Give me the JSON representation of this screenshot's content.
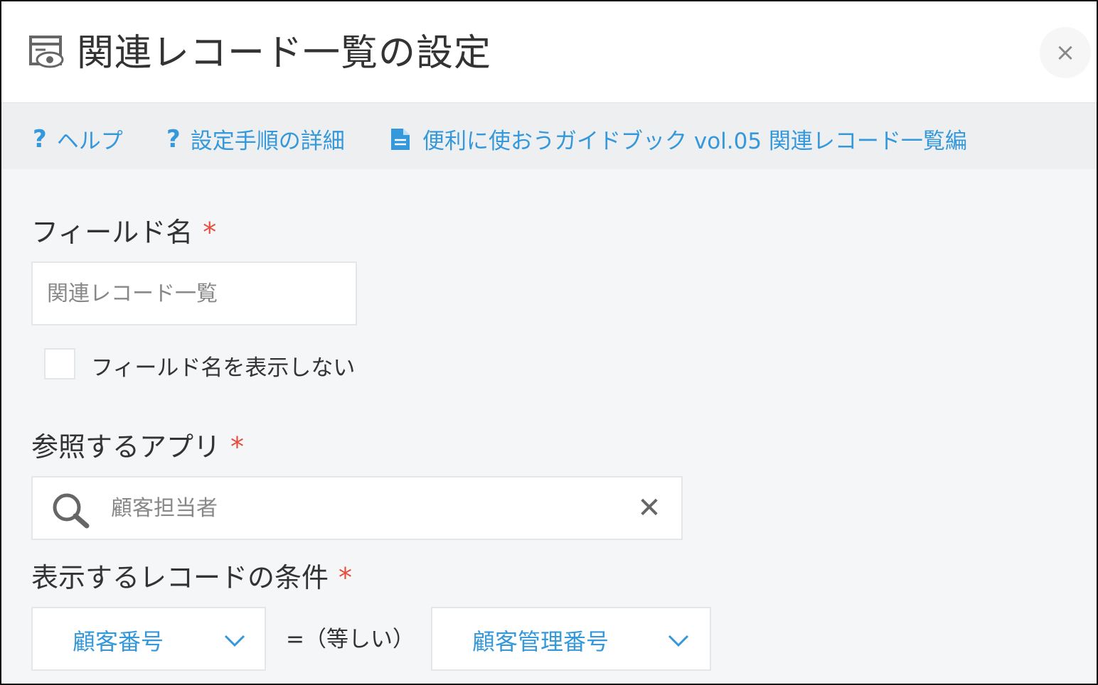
{
  "dialog": {
    "title": "関連レコード一覧の設定",
    "close_icon": "×"
  },
  "help_links": [
    {
      "icon": "?",
      "label": "ヘルプ"
    },
    {
      "icon": "?",
      "label": "設定手順の詳細"
    },
    {
      "icon": "document-icon",
      "label": "便利に使おうガイドブック vol.05 関連レコード一覧編"
    }
  ],
  "field_name": {
    "label": "フィールド名",
    "required_mark": "*",
    "placeholder": "関連レコード一覧",
    "value": "",
    "hide_checkbox_label": "フィールド名を表示しない",
    "hide_checked": false
  },
  "app": {
    "label": "参照するアプリ",
    "required_mark": "*",
    "placeholder": "顧客担当者",
    "clear_icon": "✕"
  },
  "condition": {
    "label": "表示するレコードの条件",
    "required_mark": "*",
    "left_field": "顧客番号",
    "operator": "=（等しい）",
    "right_field": "顧客管理番号"
  },
  "colors": {
    "accent": "#3498db",
    "required": "#e74c3c",
    "text": "#333333",
    "background": "#f5f6f7"
  }
}
